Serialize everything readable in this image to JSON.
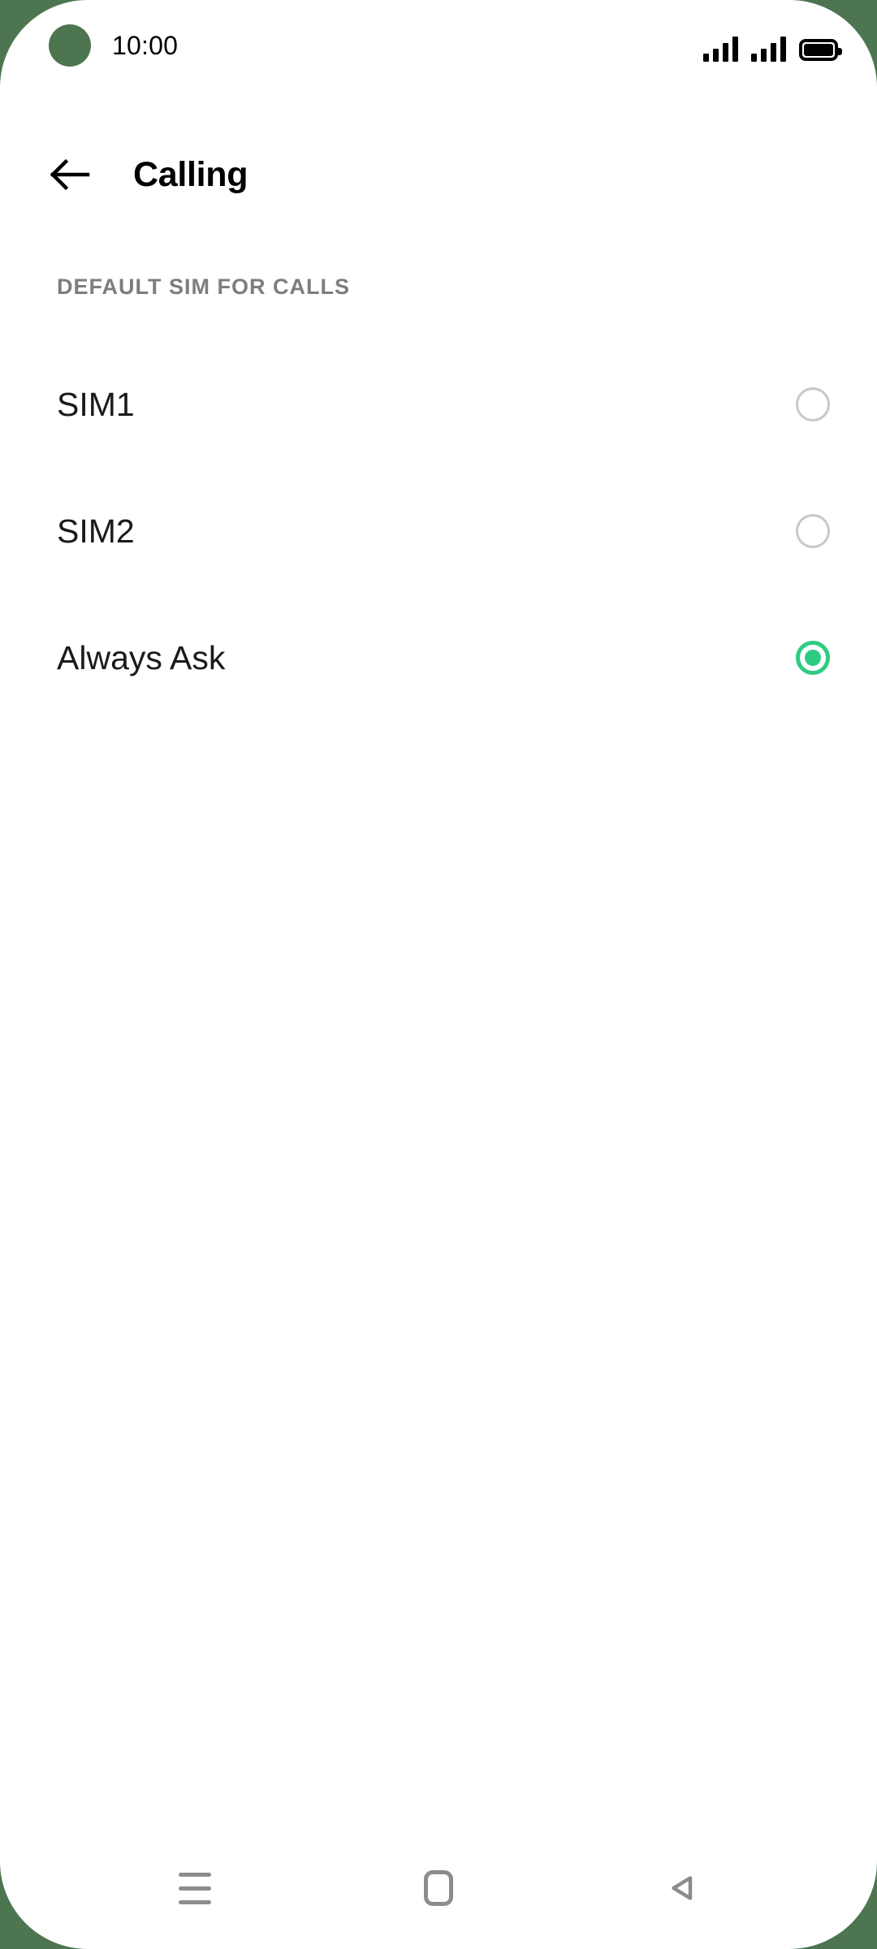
{
  "theme": {
    "screen_background": "#ffffff",
    "device_frame_color": "#4d7550",
    "accent_color": "#2ecc82",
    "radio_off_color": "#c8c8c8",
    "section_header_color": "#7d7d7d",
    "nav_icon_color": "#8c8c8c"
  },
  "status_bar": {
    "clock": "10:00",
    "camera_icon": "punch-hole-camera",
    "signal_1_icon": "cellular-signal-icon",
    "signal_1_bars": 4,
    "signal_2_icon": "cellular-signal-icon",
    "signal_2_bars": 4,
    "battery_icon": "battery-full-icon",
    "battery_level": 100
  },
  "app_bar": {
    "back_icon": "back-arrow-icon",
    "title": "Calling"
  },
  "content": {
    "section_header": "DEFAULT SIM FOR CALLS",
    "options": [
      {
        "label": "SIM1",
        "selected": false
      },
      {
        "label": "SIM2",
        "selected": false
      },
      {
        "label": "Always Ask",
        "selected": true
      }
    ]
  },
  "nav_bar": {
    "recents_icon": "recents-menu-icon",
    "home_icon": "home-square-icon",
    "back_icon": "back-triangle-icon"
  }
}
